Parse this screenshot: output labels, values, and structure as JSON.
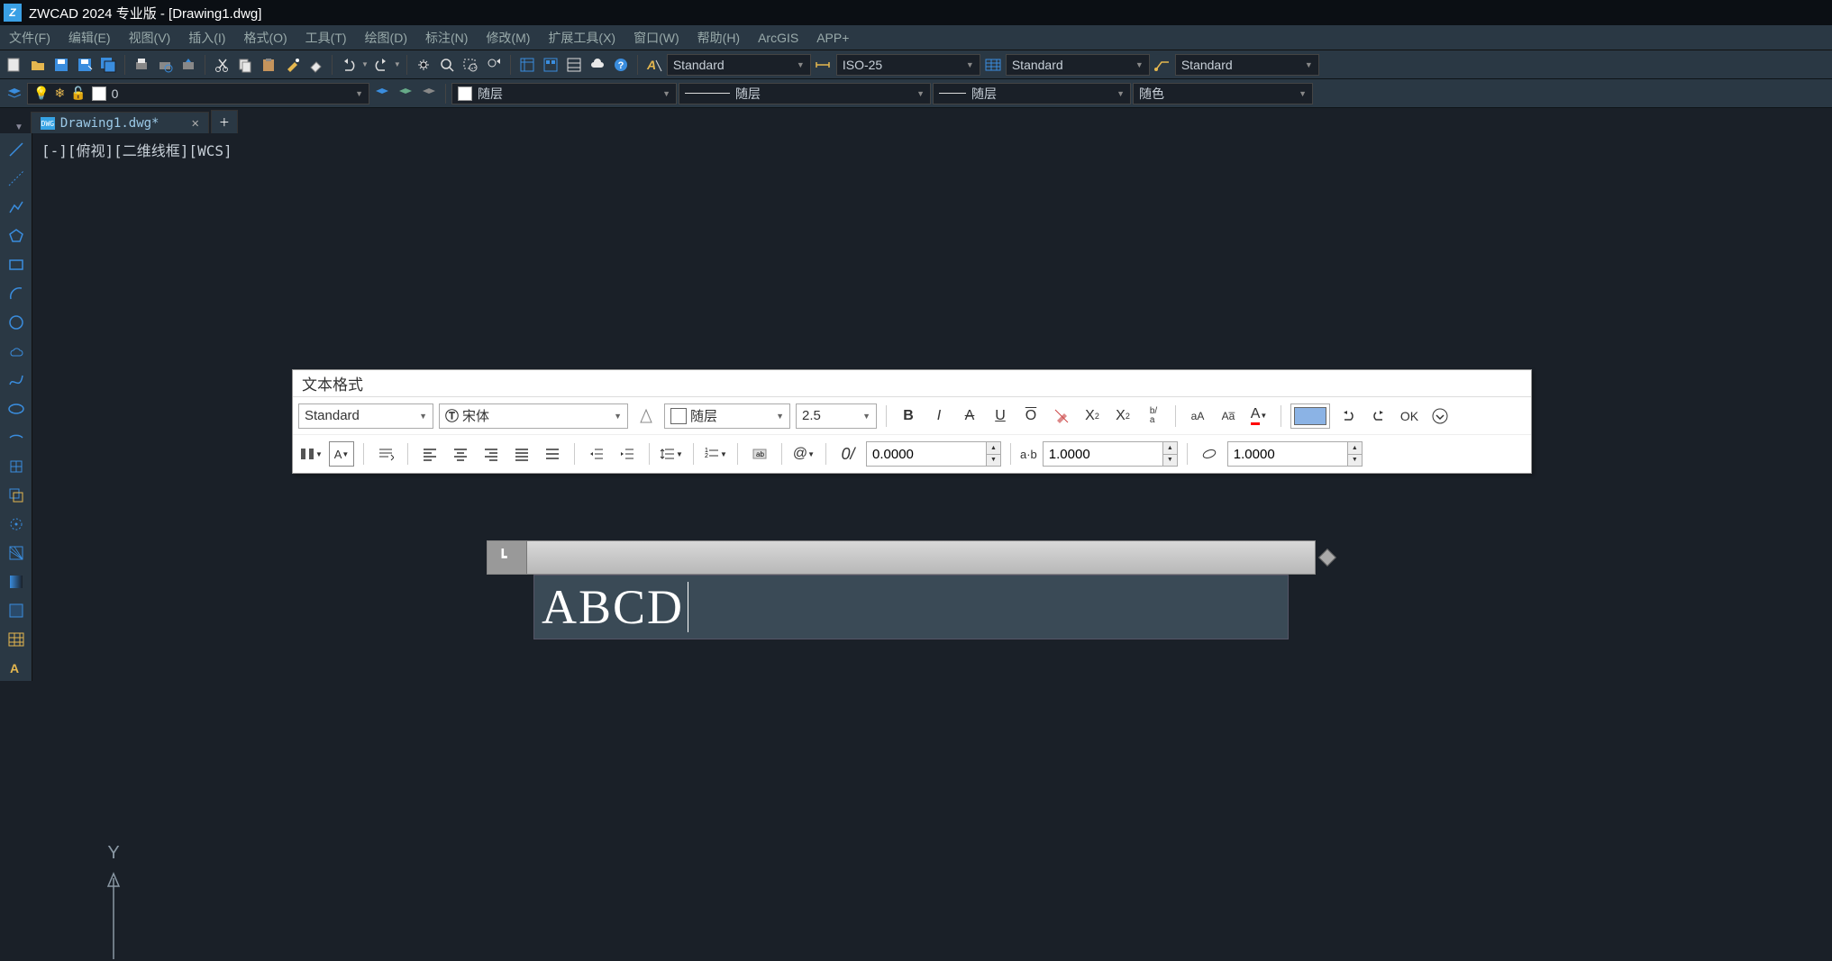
{
  "app": {
    "title": "ZWCAD 2024 专业版 - [Drawing1.dwg]"
  },
  "menu": {
    "items": [
      "文件(F)",
      "编辑(E)",
      "视图(V)",
      "插入(I)",
      "格式(O)",
      "工具(T)",
      "绘图(D)",
      "标注(N)",
      "修改(M)",
      "扩展工具(X)",
      "窗口(W)",
      "帮助(H)",
      "ArcGIS",
      "APP+"
    ]
  },
  "toolbar1": {
    "text_style": "Standard",
    "dim_style": "ISO-25",
    "table_style": "Standard",
    "mleader_style": "Standard"
  },
  "toolbar2": {
    "layer_name": "0",
    "linetype": "随层",
    "lineweight": "随层",
    "plotstyle": "随层",
    "color": "随色"
  },
  "file_tab": {
    "name": "Drawing1.dwg*"
  },
  "view_label": "[-][俯视][二维线框][WCS]",
  "text_format": {
    "title": "文本格式",
    "style": "Standard",
    "font": "宋体",
    "color_label": "随层",
    "height": "2.5",
    "ok": "OK",
    "tracking": "0.0000",
    "width_label": "a·b",
    "width_factor": "1.0000",
    "oblique": "1.0000",
    "at": "@"
  },
  "text_input": "ABCD",
  "ucs_label": "Y"
}
